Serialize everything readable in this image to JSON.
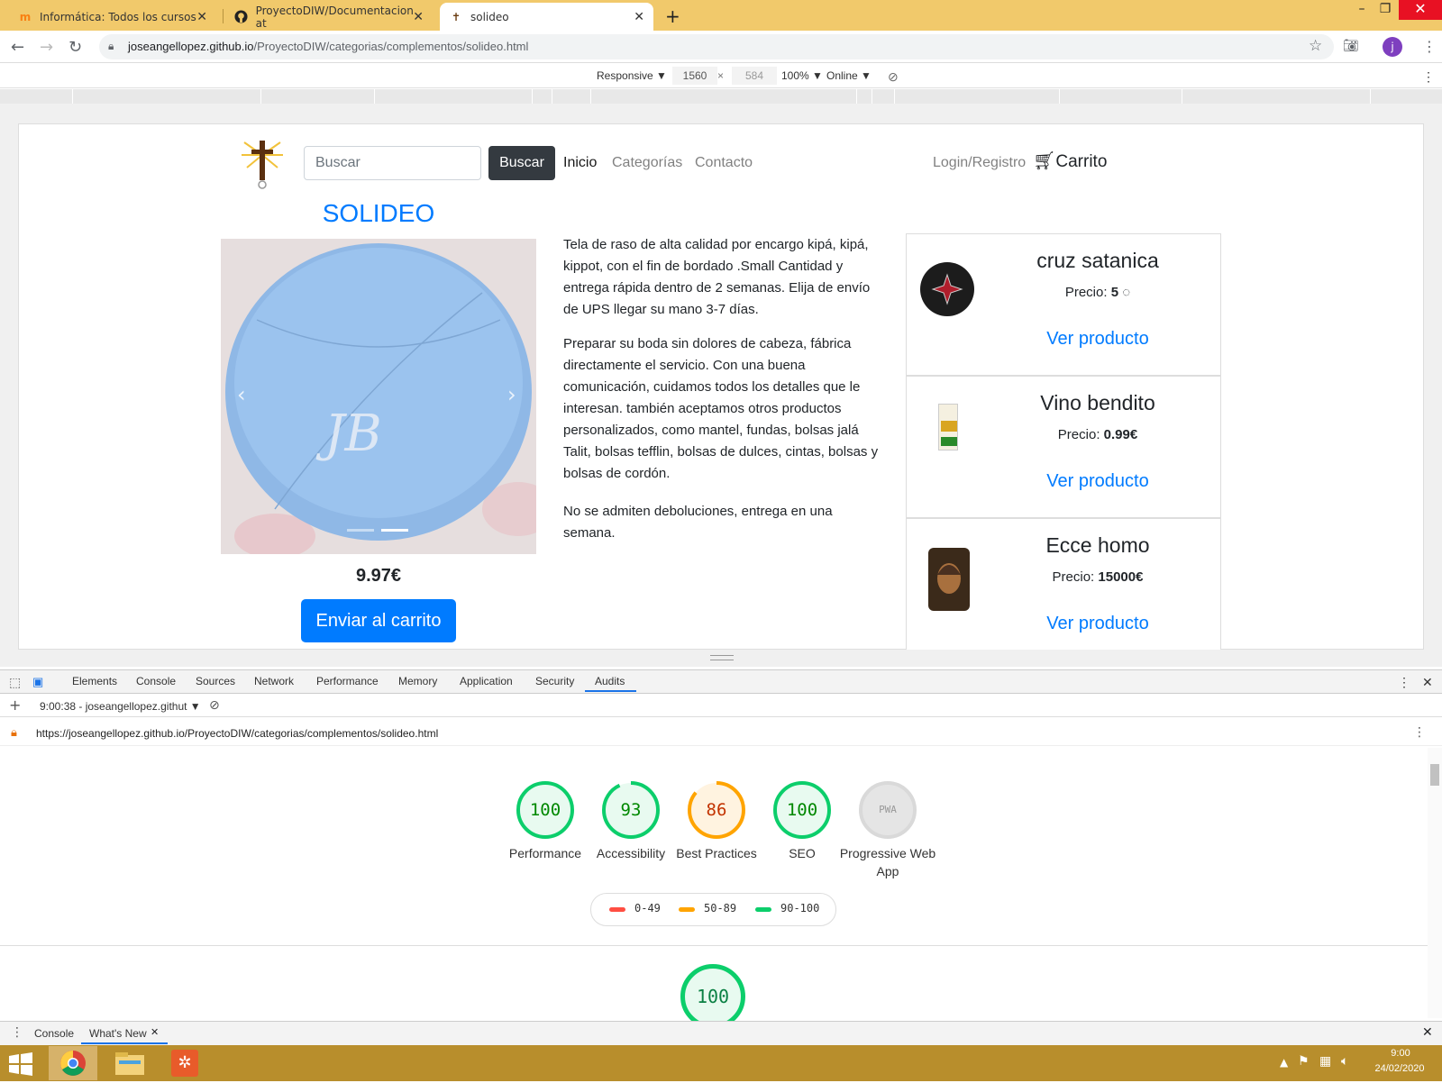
{
  "browser": {
    "tabs": [
      {
        "title": "Informática: Todos los cursos",
        "favicon": "moodle-icon"
      },
      {
        "title": "ProyectoDIW/Documentacion at",
        "favicon": "github-icon"
      },
      {
        "title": "solideo",
        "favicon": "cross-icon"
      }
    ],
    "url_domain": "joseangellopez.github.io",
    "url_path": "/ProyectoDIW/categorias/complementos/solideo.html",
    "avatar_letter": "j"
  },
  "device_toolbar": {
    "mode": "Responsive ▼",
    "width": "1560",
    "height": "584",
    "zoom": "100% ▼",
    "network": "Online ▼"
  },
  "site": {
    "search_placeholder": "Buscar",
    "search_button": "Buscar",
    "nav": [
      "Inicio",
      "Categorías",
      "Contacto"
    ],
    "login": "Login/Registro",
    "cart": "Carrito",
    "product": {
      "title": "SOLIDEO",
      "price": "9.97€",
      "buy_button": "Enviar al carrito",
      "description": [
        "Tela de raso de alta calidad por encargo kipá, kipá, kippot, con el fin de bordado .Small Cantidad y entrega rápida dentro de 2 semanas. Elija de envío de UPS llegar su mano 3-7 días.",
        "Preparar su boda sin dolores de cabeza, fábrica directamente el servicio. Con una buena comunicación, cuidamos todos los detalles que le interesan. también aceptamos otros productos personalizados, como mantel, fundas, bolsas jalá Talit, bolsas tefflin, bolsas de dulces, cintas, bolsas y bolsas de cordón.",
        "No se admiten deboluciones, entrega en una semana."
      ]
    },
    "price_label": "Precio:",
    "related": [
      {
        "name": "cruz satanica",
        "price": "5",
        "link": "Ver producto"
      },
      {
        "name": "Vino bendito",
        "price": "0.99€",
        "link": "Ver producto"
      },
      {
        "name": "Ecce homo",
        "price": "15000€",
        "link": "Ver producto"
      }
    ]
  },
  "devtools": {
    "tabs": [
      "Elements",
      "Console",
      "Sources",
      "Network",
      "Performance",
      "Memory",
      "Application",
      "Security",
      "Audits"
    ],
    "active_tab": "Audits",
    "report_time": "9:00:38 - joseangellopez.githut ▼",
    "report_url": "https://joseangellopez.github.io/ProyectoDIW/categorias/complementos/solideo.html",
    "scores": [
      {
        "label": "Performance",
        "score": "100",
        "color": "#0cce6b"
      },
      {
        "label": "Accessibility",
        "score": "93",
        "color": "#0cce6b"
      },
      {
        "label": "Best Practices",
        "score": "86",
        "color": "#ffa400"
      },
      {
        "label": "SEO",
        "score": "100",
        "color": "#0cce6b"
      },
      {
        "label": "Progressive Web App",
        "score": "PWA",
        "color": "#d9d9d9"
      }
    ],
    "legend": [
      "0-49",
      "50-89",
      "90-100"
    ],
    "legend_colors": [
      "#ff4e42",
      "#ffa400",
      "#0cce6b"
    ],
    "bottom_score": "100",
    "drawer_tabs": [
      "Console",
      "What's New"
    ]
  },
  "taskbar": {
    "time": "9:00",
    "date": "24/02/2020"
  }
}
